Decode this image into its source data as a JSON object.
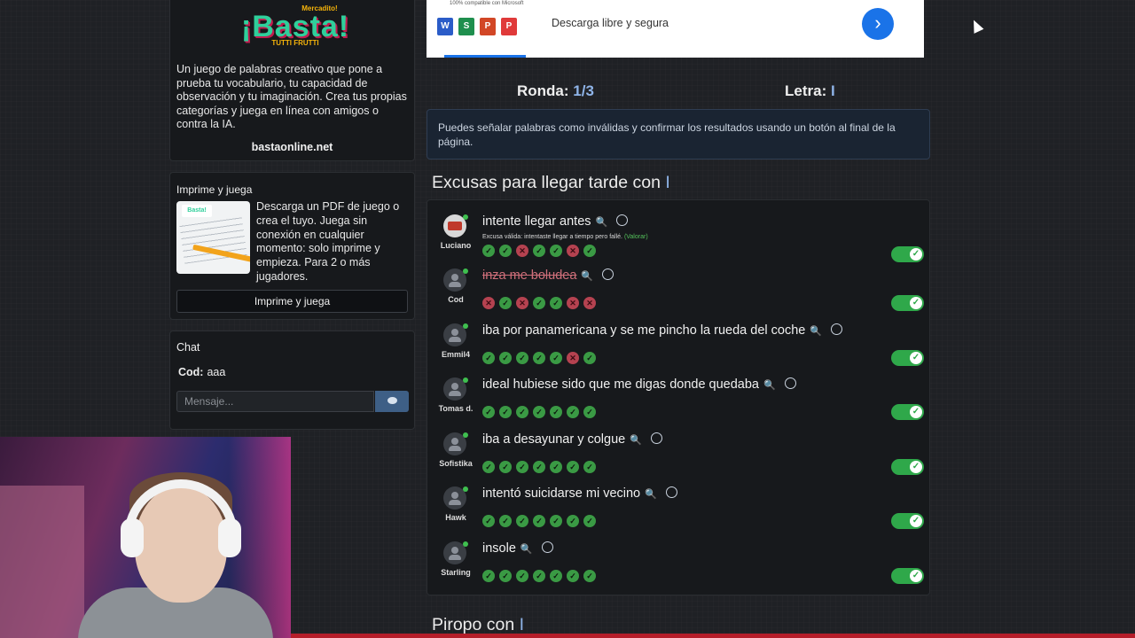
{
  "promo": {
    "logo_small": "Mercadito!",
    "logo_big": "¡Basta!",
    "logo_sub": "TUTTI FRUTTI",
    "description": "Un juego de palabras creativo que pone a prueba tu vocabulario, tu capacidad de observación y tu imaginación. Crea tus propias categorías y juega en línea con amigos o contra la IA.",
    "link": "bastaonline.net"
  },
  "print_card": {
    "title": "Imprime y juega",
    "thumb_label": "Basta!",
    "description": "Descarga un PDF de juego o crea el tuyo. Juega sin conexión en cualquier momento: solo imprime y empieza. Para 2 o más jugadores.",
    "button": "Imprime y juega"
  },
  "chat": {
    "title": "Chat",
    "message_user": "Cod:",
    "message_text": "aaa",
    "input_placeholder": "Mensaje..."
  },
  "ad": {
    "tiny": "100% compatible con Microsoft",
    "text": "Descarga libre y segura",
    "icons": [
      "W",
      "S",
      "P",
      "P"
    ],
    "icon_colors": [
      "#2b5cc8",
      "#1f8f4e",
      "#d24726",
      "#e03a3a"
    ]
  },
  "game": {
    "round_label": "Ronda:",
    "round_value": "1/3",
    "letter_label": "Letra:",
    "letter_value": "I",
    "info": "Puedes señalar palabras como inválidas y confirmar los resultados usando un botón al final de la página."
  },
  "category": {
    "title": "Excusas para llegar tarde con ",
    "letter": "I",
    "answers": [
      {
        "player": "Luciano",
        "word": "intente llegar antes",
        "note": "Excusa válida: intentaste llegar a tiempo pero fallé.",
        "note_action": "(Valorar)",
        "votes": [
          "yes",
          "yes",
          "no",
          "yes",
          "yes",
          "no",
          "yes"
        ],
        "valid": true
      },
      {
        "player": "Cod",
        "word": "inza me boludea",
        "votes": [
          "no",
          "yes",
          "no",
          "yes",
          "yes",
          "no",
          "no"
        ],
        "valid": false
      },
      {
        "player": "Emmil4",
        "word": "iba por panamericana y se me pincho la rueda del coche",
        "votes": [
          "yes",
          "yes",
          "yes",
          "yes",
          "yes",
          "no",
          "yes"
        ],
        "valid": true
      },
      {
        "player": "Tomas d.",
        "word": "ideal hubiese sido que me digas donde quedaba",
        "votes": [
          "yes",
          "yes",
          "yes",
          "yes",
          "yes",
          "yes",
          "yes"
        ],
        "valid": true
      },
      {
        "player": "Sofistika",
        "word": "iba a desayunar y colgue",
        "votes": [
          "yes",
          "yes",
          "yes",
          "yes",
          "yes",
          "yes",
          "yes"
        ],
        "valid": true
      },
      {
        "player": "Hawk",
        "word": "intentó suicidarse mi vecino",
        "votes": [
          "yes",
          "yes",
          "yes",
          "yes",
          "yes",
          "yes",
          "yes"
        ],
        "valid": true
      },
      {
        "player": "Starling",
        "word": "insole",
        "votes": [
          "yes",
          "yes",
          "yes",
          "yes",
          "yes",
          "yes",
          "yes"
        ],
        "valid": true
      }
    ]
  },
  "next_category": {
    "title": "Piropo con ",
    "letter": "I"
  },
  "icons": {
    "search": "magnifier-icon",
    "react": "smiley-icon",
    "send": "chat-bubble-icon",
    "next": "chevron-right-icon"
  },
  "colors": {
    "accent": "#8fb4e8",
    "vote_yes": "#3a9a44",
    "vote_no": "#b54250",
    "toggle_on": "#2fa84a"
  }
}
